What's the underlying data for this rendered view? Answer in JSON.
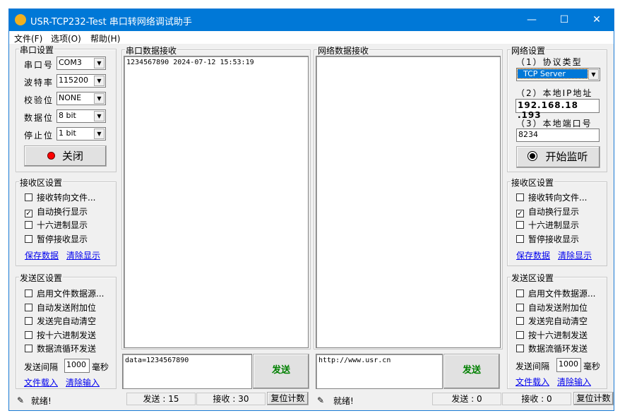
{
  "window": {
    "title": "USR-TCP232-Test 串口转网络调试助手",
    "minimize": "—",
    "maximize": "☐",
    "close": "✕"
  },
  "menu": [
    "文件(F)",
    "选项(O)",
    "帮助(H)"
  ],
  "serial": {
    "group": "串口设置",
    "port_label": "串口号",
    "port": "COM3",
    "baud_label": "波特率",
    "baud": "115200",
    "parity_label": "校验位",
    "parity": "NONE",
    "data_label": "数据位",
    "data": "8 bit",
    "stop_label": "停止位",
    "stop": "1 bit",
    "toggle": "关闭"
  },
  "recv_left": {
    "group": "接收区设置",
    "options": [
      {
        "label": "接收转向文件...",
        "checked": false
      },
      {
        "label": "自动换行显示",
        "checked": true
      },
      {
        "label": "十六进制显示",
        "checked": false
      },
      {
        "label": "暂停接收显示",
        "checked": false
      }
    ],
    "save": "保存数据",
    "clear": "清除显示"
  },
  "send_left": {
    "group": "发送区设置",
    "options": [
      {
        "label": "启用文件数据源...",
        "checked": false
      },
      {
        "label": "自动发送附加位",
        "checked": false
      },
      {
        "label": "发送完自动清空",
        "checked": false
      },
      {
        "label": "按十六进制发送",
        "checked": false
      },
      {
        "label": "数据流循环发送",
        "checked": false
      }
    ],
    "interval_label": "发送间隔",
    "interval": "1000",
    "unit": "毫秒",
    "load": "文件载入",
    "clear": "清除输入"
  },
  "serial_recv": {
    "group": "串口数据接收",
    "content": "1234567890 2024-07-12 15:53:19"
  },
  "net_recv": {
    "group": "网络数据接收",
    "content": ""
  },
  "network": {
    "group": "网络设置",
    "proto_label": "（1）协议类型",
    "proto": "TCP Server",
    "ip_label": "（2）本地IP地址",
    "ip": "192.168.18 .193",
    "port_label": "（3）本地端口号",
    "port": "8234",
    "listen": "开始监听"
  },
  "recv_right": {
    "group": "接收区设置",
    "options": [
      {
        "label": "接收转向文件...",
        "checked": false
      },
      {
        "label": "自动换行显示",
        "checked": true
      },
      {
        "label": "十六进制显示",
        "checked": false
      },
      {
        "label": "暂停接收显示",
        "checked": false
      }
    ],
    "save": "保存数据",
    "clear": "清除显示"
  },
  "send_right": {
    "group": "发送区设置",
    "options": [
      {
        "label": "启用文件数据源...",
        "checked": false
      },
      {
        "label": "自动发送附加位",
        "checked": false
      },
      {
        "label": "发送完自动清空",
        "checked": false
      },
      {
        "label": "按十六进制发送",
        "checked": false
      },
      {
        "label": "数据流循环发送",
        "checked": false
      }
    ],
    "interval_label": "发送间隔",
    "interval": "1000",
    "unit": "毫秒",
    "load": "文件载入",
    "clear": "清除输入"
  },
  "serial_send": {
    "content": "data=1234567890",
    "button": "发送"
  },
  "net_send": {
    "content": "http://www.usr.cn",
    "button": "发送"
  },
  "status_left": {
    "ready": "就绪!",
    "sent": "发送 : 15",
    "received": "接收 : 30",
    "reset": "复位计数"
  },
  "status_right": {
    "ready": "就绪!",
    "sent": "发送 : 0",
    "received": "接收 : 0",
    "reset": "复位计数"
  }
}
